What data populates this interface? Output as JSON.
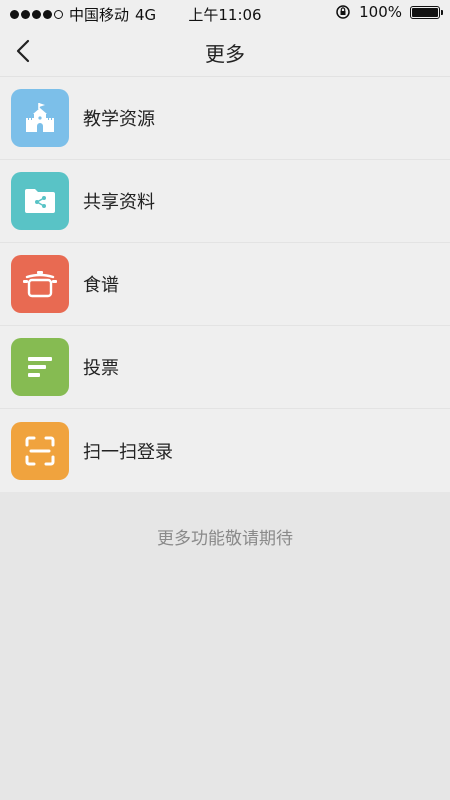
{
  "status_bar": {
    "carrier": "中国移动",
    "network": "4G",
    "time": "上午11:06",
    "battery": "100%",
    "battery_level": 1.0
  },
  "nav": {
    "title": "更多"
  },
  "items": [
    {
      "label": "教学资源",
      "icon": "castle-icon",
      "color": "#7cbfe9"
    },
    {
      "label": "共享资料",
      "icon": "shared-folder-icon",
      "color": "#59c3c6"
    },
    {
      "label": "食谱",
      "icon": "cooking-pot-icon",
      "color": "#e86a52"
    },
    {
      "label": "投票",
      "icon": "poll-bars-icon",
      "color": "#86bb52"
    },
    {
      "label": "扫一扫登录",
      "icon": "scan-icon",
      "color": "#f0a33e"
    }
  ],
  "footer_note": "更多功能敬请期待"
}
